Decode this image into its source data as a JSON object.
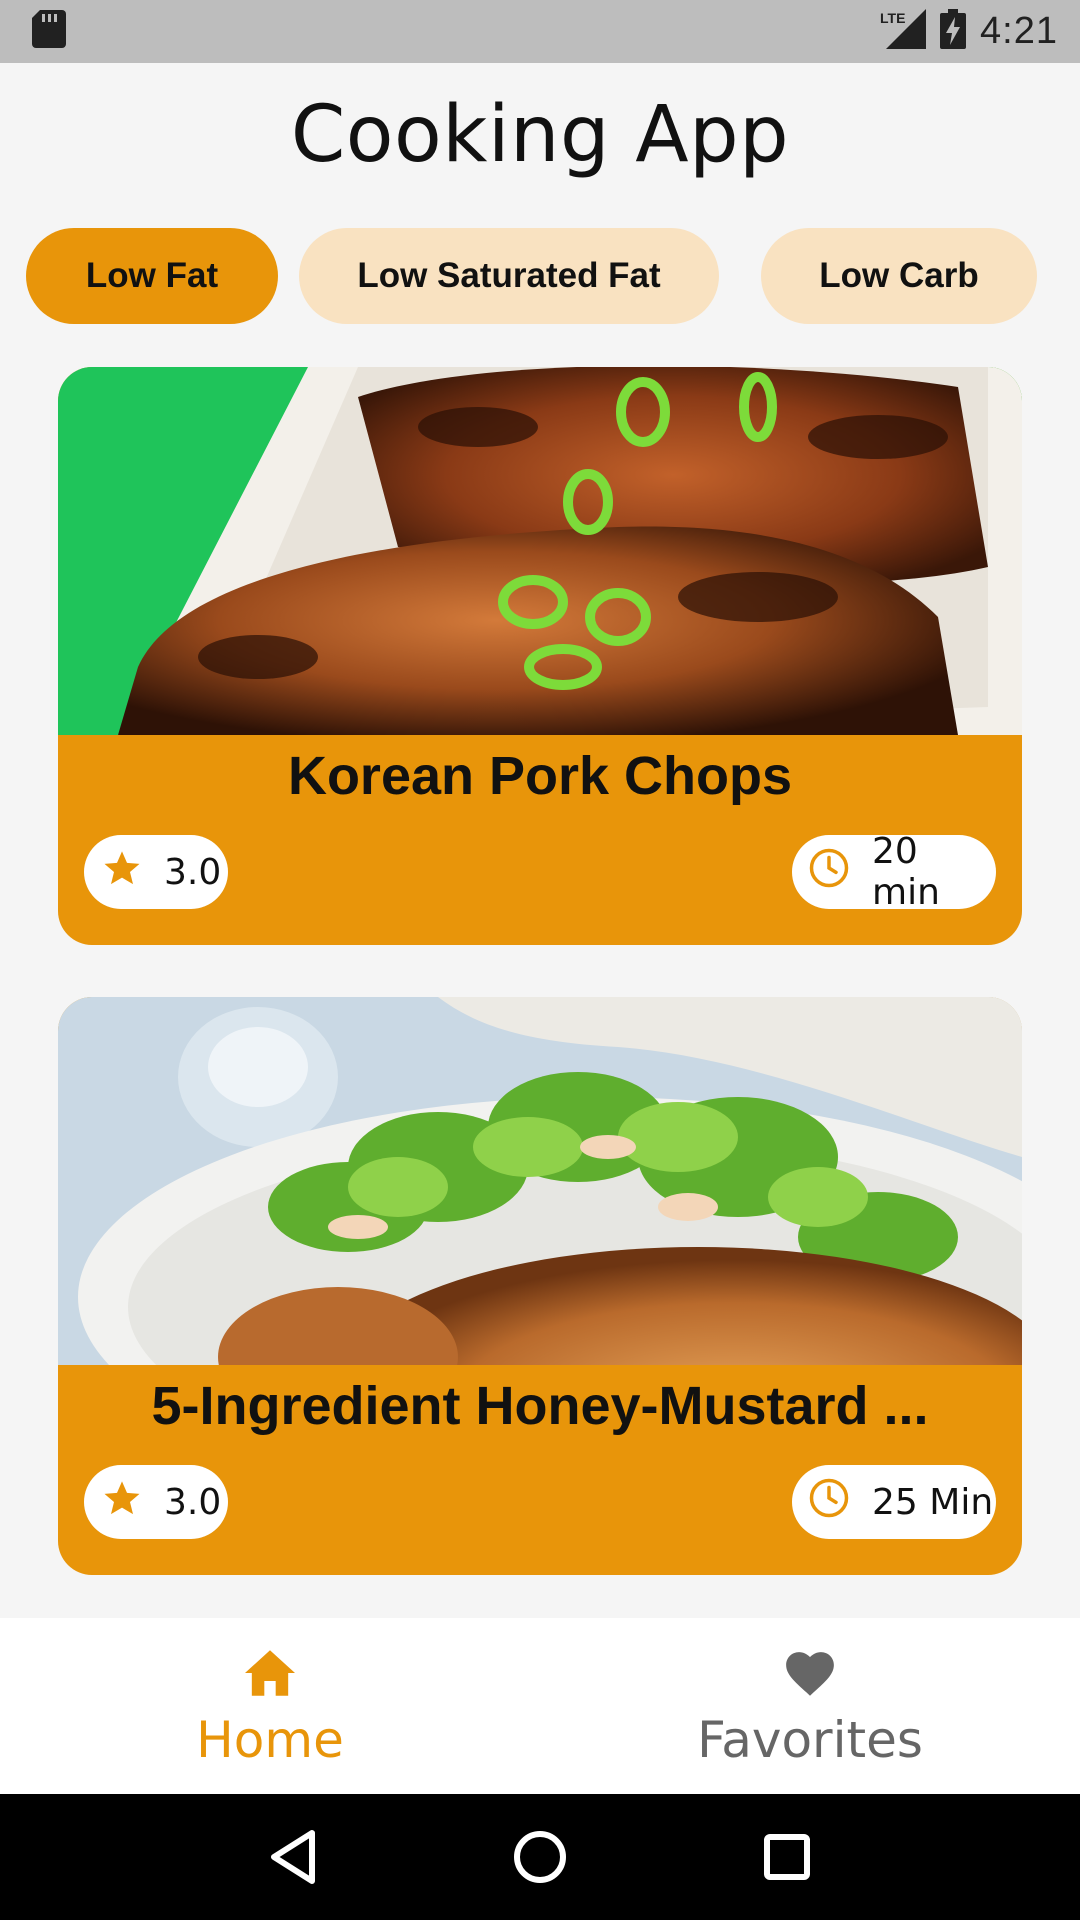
{
  "status_bar": {
    "network": "LTE",
    "time": "4:21",
    "icons": [
      "sd-card-icon",
      "lte-signal-icon",
      "battery-charging-icon"
    ]
  },
  "app": {
    "title": "Cooking App"
  },
  "filters": {
    "chips": [
      {
        "label": "Low Fat",
        "selected": true
      },
      {
        "label": "Low Saturated Fat",
        "selected": false
      },
      {
        "label": "Low Carb",
        "selected": false
      }
    ]
  },
  "recipes": [
    {
      "title": "Korean Pork Chops",
      "rating": "3.0",
      "time": "20 min",
      "image": "pork-chops-photo"
    },
    {
      "title": "5-Ingredient Honey-Mustard ...",
      "rating": "3.0",
      "time": "25 Min",
      "image": "honey-mustard-chicken-salad-photo"
    }
  ],
  "bottom_nav": {
    "items": [
      {
        "label": "Home",
        "icon": "home-icon",
        "active": true
      },
      {
        "label": "Favorites",
        "icon": "heart-icon",
        "active": false
      }
    ]
  },
  "colors": {
    "accent": "#e8950a",
    "chip_inactive": "#f9e2c1",
    "background": "#f5f5f5",
    "status_bar": "#bdbdbd"
  }
}
